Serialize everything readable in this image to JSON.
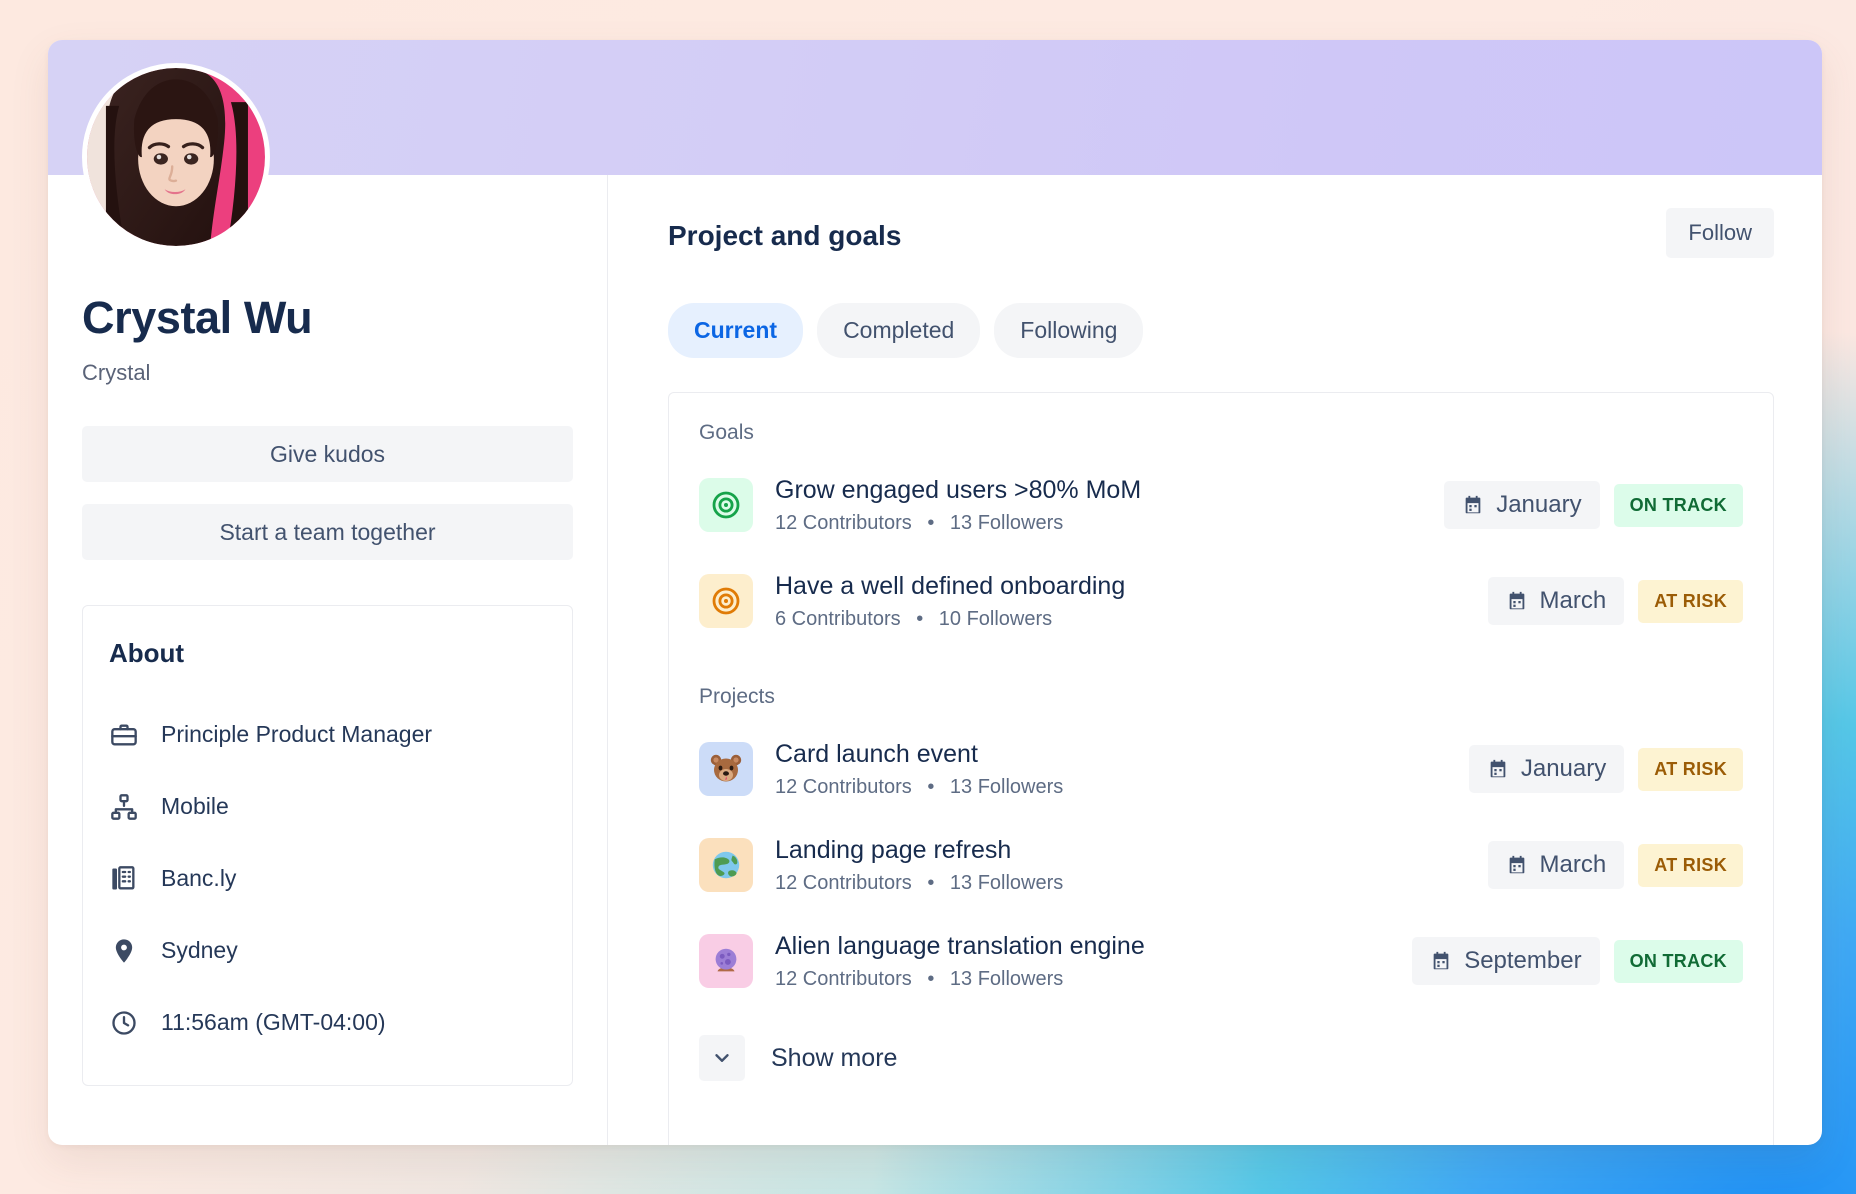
{
  "profile": {
    "name": "Crystal Wu",
    "handle": "Crystal",
    "avatar_alt": "profile-photo",
    "actions": {
      "give_kudos": "Give kudos",
      "start_team": "Start a team together"
    },
    "about": {
      "title": "About",
      "items": [
        {
          "icon": "briefcase-icon",
          "label": "Principle Product Manager"
        },
        {
          "icon": "org-chart-icon",
          "label": "Mobile"
        },
        {
          "icon": "building-icon",
          "label": "Banc.ly"
        },
        {
          "icon": "location-pin-icon",
          "label": "Sydney"
        },
        {
          "icon": "clock-icon",
          "label": "11:56am (GMT-04:00)"
        }
      ]
    }
  },
  "main": {
    "title": "Project and goals",
    "follow_label": "Follow",
    "tabs": [
      {
        "label": "Current",
        "active": true
      },
      {
        "label": "Completed",
        "active": false
      },
      {
        "label": "Following",
        "active": false
      }
    ],
    "sections": [
      {
        "label": "Goals",
        "rows": [
          {
            "icon": "target-icon-green",
            "icon_bg": "#dcfce9",
            "title": "Grow engaged users >80% MoM",
            "contributors": "12 Contributors",
            "followers": "13 Followers",
            "date": "January",
            "status": "ON TRACK",
            "status_kind": "ontrack"
          },
          {
            "icon": "target-icon-orange",
            "icon_bg": "#fdeecd",
            "title": "Have a well defined onboarding",
            "contributors": "6 Contributors",
            "followers": "10 Followers",
            "date": "March",
            "status": "AT RISK",
            "status_kind": "atrisk"
          }
        ]
      },
      {
        "label": "Projects",
        "rows": [
          {
            "icon": "bear-face-icon",
            "icon_bg": "#ccdcf8",
            "title": "Card launch event",
            "contributors": "12 Contributors",
            "followers": "13 Followers",
            "date": "January",
            "status": "AT RISK",
            "status_kind": "atrisk"
          },
          {
            "icon": "globe-icon",
            "icon_bg": "#fbe0bd",
            "title": "Landing page refresh",
            "contributors": "12 Contributors",
            "followers": "13 Followers",
            "date": "March",
            "status": "AT RISK",
            "status_kind": "atrisk"
          },
          {
            "icon": "crystal-ball-icon",
            "icon_bg": "#f9cde5",
            "title": "Alien language translation engine",
            "contributors": "12 Contributors",
            "followers": "13 Followers",
            "date": "September",
            "status": "ON TRACK",
            "status_kind": "ontrack"
          }
        ]
      }
    ],
    "show_more_label": "Show more",
    "separator": "•"
  },
  "colors": {
    "banner": "#d0cbf7",
    "accent_blue": "#0c66e4",
    "text_primary": "#172b4d",
    "text_muted": "#5e6c84",
    "surface_subtle": "#f4f5f7",
    "ontrack_bg": "#dcfcea",
    "ontrack_fg": "#106b35",
    "atrisk_bg": "#fdf3d2",
    "atrisk_fg": "#9b5c06"
  }
}
